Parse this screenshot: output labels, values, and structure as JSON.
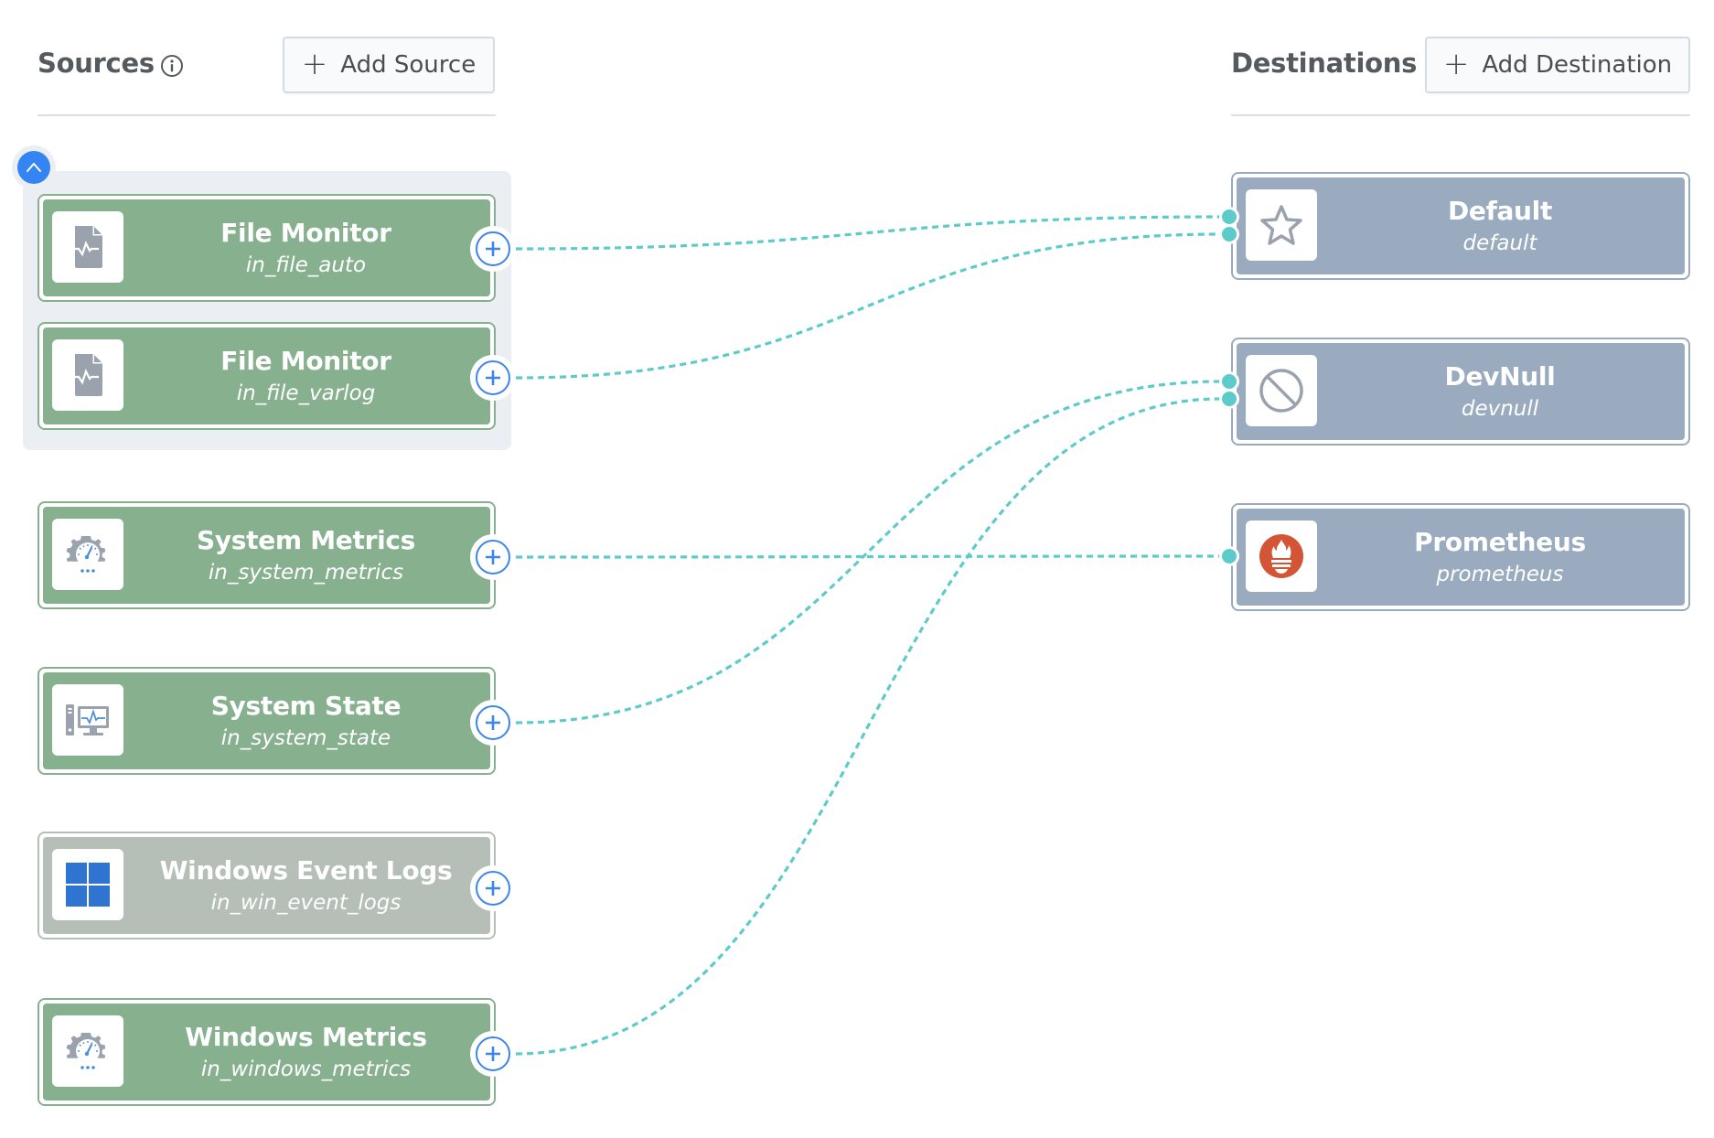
{
  "sources": {
    "title": "Sources",
    "info_icon": "info-icon",
    "add_button_label": "Add Source",
    "collapse_icon": "chevron-up-icon",
    "items": [
      {
        "name": "File Monitor",
        "id": "in_file_auto",
        "icon": "file-monitor-icon",
        "enabled": true,
        "grouped": true
      },
      {
        "name": "File Monitor",
        "id": "in_file_varlog",
        "icon": "file-monitor-icon",
        "enabled": true,
        "grouped": true
      },
      {
        "name": "System Metrics",
        "id": "in_system_metrics",
        "icon": "gauge-gear-icon",
        "enabled": true,
        "grouped": false
      },
      {
        "name": "System State",
        "id": "in_system_state",
        "icon": "computer-monitor-icon",
        "enabled": true,
        "grouped": false
      },
      {
        "name": "Windows Event Logs",
        "id": "in_win_event_logs",
        "icon": "windows-logo-icon",
        "enabled": false,
        "grouped": false
      },
      {
        "name": "Windows Metrics",
        "id": "in_windows_metrics",
        "icon": "gauge-gear-icon",
        "enabled": true,
        "grouped": false
      }
    ]
  },
  "destinations": {
    "title": "Destinations",
    "add_button_label": "Add Destination",
    "items": [
      {
        "name": "Default",
        "id": "default",
        "icon": "star-icon"
      },
      {
        "name": "DevNull",
        "id": "devnull",
        "icon": "no-entry-icon"
      },
      {
        "name": "Prometheus",
        "id": "prometheus",
        "icon": "prometheus-icon"
      }
    ]
  },
  "connections": [
    {
      "from": "in_file_auto",
      "to": "default"
    },
    {
      "from": "in_file_varlog",
      "to": "default"
    },
    {
      "from": "in_system_metrics",
      "to": "prometheus"
    },
    {
      "from": "in_system_state",
      "to": "devnull"
    },
    {
      "from": "in_windows_metrics",
      "to": "devnull"
    }
  ],
  "colors": {
    "source_enabled": "#87b08f",
    "source_disabled": "#b5beb7",
    "destination": "#9aabc0",
    "connection": "#5ecbcb",
    "accent_blue": "#3584f4",
    "prometheus": "#d35535"
  }
}
